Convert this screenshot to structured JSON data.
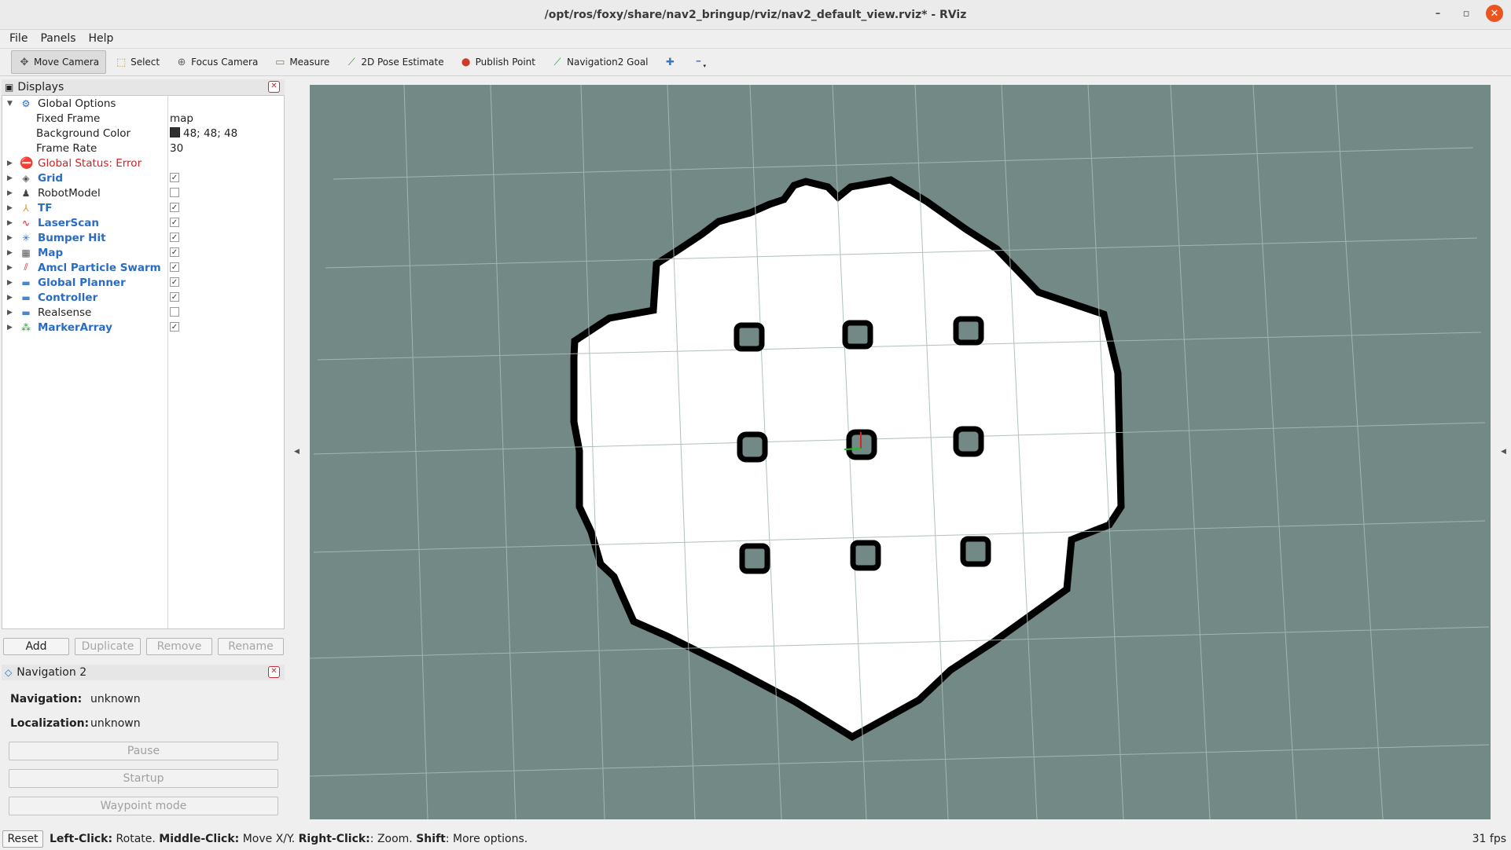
{
  "window": {
    "title": "/opt/ros/foxy/share/nav2_bringup/rviz/nav2_default_view.rviz* - RViz",
    "controls": {
      "minimize": "–",
      "maximize": "▫",
      "close": "✕"
    }
  },
  "menu": [
    {
      "label": "File"
    },
    {
      "label": "Panels"
    },
    {
      "label": "Help"
    }
  ],
  "toolbar": {
    "tools": [
      {
        "label": "Move Camera",
        "icon": "move-camera-icon",
        "glyph": "✥",
        "active": true
      },
      {
        "label": "Select",
        "icon": "select-icon",
        "glyph": "⬚",
        "active": false
      },
      {
        "label": "Focus Camera",
        "icon": "focus-camera-icon",
        "glyph": "⊕",
        "active": false
      },
      {
        "label": "Measure",
        "icon": "measure-icon",
        "glyph": "▭",
        "active": false
      },
      {
        "label": "2D Pose Estimate",
        "icon": "pose-estimate-icon",
        "glyph": "⟋",
        "active": false
      },
      {
        "label": "Publish Point",
        "icon": "publish-point-icon",
        "glyph": "⬤",
        "active": false
      },
      {
        "label": "Navigation2 Goal",
        "icon": "nav-goal-icon",
        "glyph": "⟋",
        "active": false
      }
    ],
    "add_glyph": "✚",
    "remove_glyph": "━"
  },
  "displays": {
    "title": "Displays",
    "close_glyph": "✕",
    "global_options": {
      "label": "Global Options",
      "props": [
        {
          "name": "Fixed Frame",
          "value": "map"
        },
        {
          "name": "Background Color",
          "value": "48; 48; 48"
        },
        {
          "name": "Frame Rate",
          "value": "30"
        }
      ]
    },
    "global_status": "Global Status: Error",
    "items": [
      {
        "label": "Grid",
        "checked": true,
        "icon": "grid-icon",
        "glyph": "◈",
        "color": "#555555"
      },
      {
        "label": "RobotModel",
        "checked": false,
        "icon": "robot-model-icon",
        "glyph": "♟",
        "color": "#444444"
      },
      {
        "label": "TF",
        "checked": true,
        "icon": "tf-icon",
        "glyph": "⅄",
        "color": "#d49a2a"
      },
      {
        "label": "LaserScan",
        "checked": true,
        "icon": "laserscan-icon",
        "glyph": "∿",
        "color": "#d42020"
      },
      {
        "label": "Bumper Hit",
        "checked": true,
        "icon": "bumper-hit-icon",
        "glyph": "✳",
        "color": "#2a6cc4"
      },
      {
        "label": "Map",
        "checked": true,
        "icon": "map-icon",
        "glyph": "▦",
        "color": "#555555"
      },
      {
        "label": "Amcl Particle Swarm",
        "checked": true,
        "icon": "particle-swarm-icon",
        "glyph": "⫽",
        "color": "#d42020"
      },
      {
        "label": "Global Planner",
        "checked": true,
        "icon": "folder-icon",
        "glyph": "▬",
        "color": "#4a86d0"
      },
      {
        "label": "Controller",
        "checked": true,
        "icon": "folder-icon",
        "glyph": "▬",
        "color": "#4a86d0"
      },
      {
        "label": "Realsense",
        "checked": false,
        "icon": "folder-icon",
        "glyph": "▬",
        "color": "#4a86d0"
      },
      {
        "label": "MarkerArray",
        "checked": true,
        "icon": "marker-array-icon",
        "glyph": "⁂",
        "color": "#2a9a3a"
      }
    ],
    "buttons": [
      {
        "label": "Add",
        "disabled": false
      },
      {
        "label": "Duplicate",
        "disabled": true
      },
      {
        "label": "Remove",
        "disabled": true
      },
      {
        "label": "Rename",
        "disabled": true
      }
    ]
  },
  "navigation": {
    "title": "Navigation 2",
    "close_glyph": "✕",
    "navigation_label": "Navigation:",
    "navigation_value": "unknown",
    "localization_label": "Localization:",
    "localization_value": "unknown",
    "pause_label": "Pause",
    "startup_label": "Startup",
    "waypoint_label": "Waypoint mode"
  },
  "status": {
    "reset_label": "Reset",
    "hint_parts": [
      {
        "bold": "Left-Click:",
        "text": " Rotate. "
      },
      {
        "bold": "Middle-Click:",
        "text": " Move X/Y. "
      },
      {
        "bold": "Right-Click:",
        "text": ": Zoom. "
      },
      {
        "bold": "Shift",
        "text": ": More options."
      }
    ],
    "fps": "31 fps"
  },
  "colors": {
    "viewport_bg": "#728985",
    "free_space": "#ffffff",
    "occupied": "#000000",
    "grid_line": "#a8bab6",
    "status_error": "#d42020",
    "link_blue": "#2a6cc4"
  }
}
